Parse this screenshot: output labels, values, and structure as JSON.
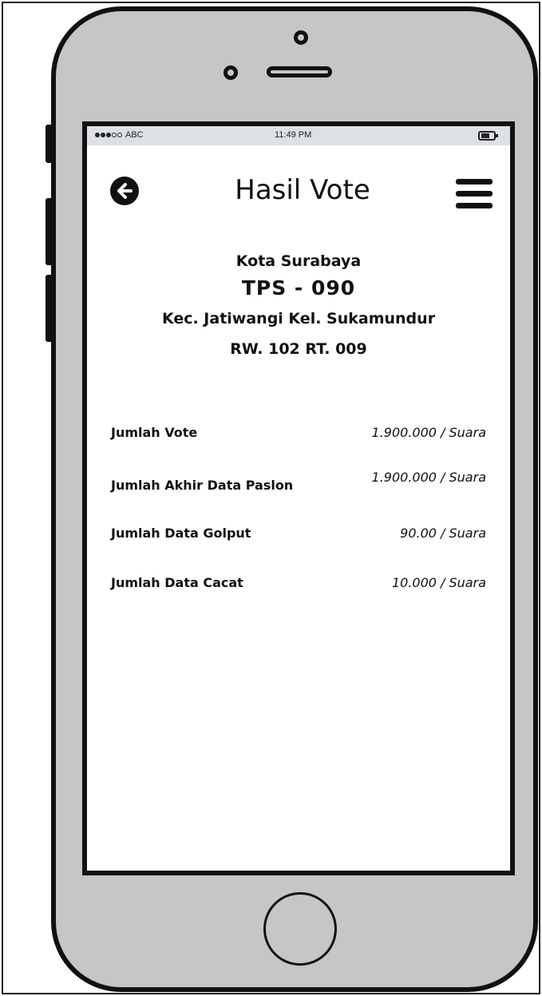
{
  "status_bar": {
    "carrier": "ABC",
    "time": "11:49 PM"
  },
  "header": {
    "title": "Hasil Vote"
  },
  "location": {
    "city": "Kota Surabaya",
    "tps": "TPS - 090",
    "district": "Kec. Jatiwangi Kel. Sukamundur",
    "rw_rt": "RW. 102 RT. 009"
  },
  "stats": [
    {
      "label": "Jumlah Vote",
      "value": "1.900.000 / Suara"
    },
    {
      "label": "Jumlah Akhir Data Paslon",
      "value": "1.900.000 / Suara"
    },
    {
      "label": "Jumlah Data Golput",
      "value": "90.00 / Suara"
    },
    {
      "label": "Jumlah Data Cacat",
      "value": "10.000 / Suara"
    }
  ],
  "icons": {
    "back": "arrow-left-circle-icon",
    "menu": "hamburger-menu-icon",
    "battery": "battery-icon"
  }
}
